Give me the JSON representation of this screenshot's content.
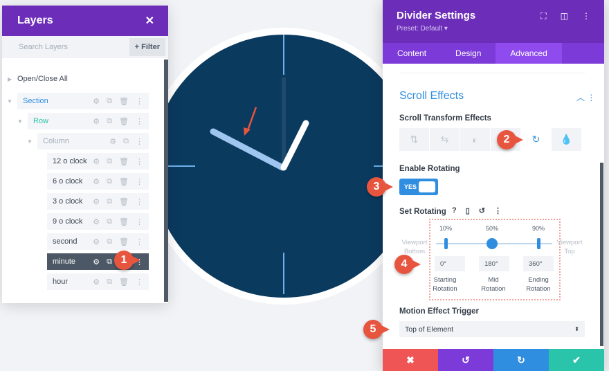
{
  "layers": {
    "title": "Layers",
    "search_placeholder": "Search Layers",
    "filter": "+ Filter",
    "open_close": "Open/Close All",
    "items": [
      {
        "label": "Section"
      },
      {
        "label": "Row"
      },
      {
        "label": "Column"
      },
      {
        "label": "12 o clock"
      },
      {
        "label": "6 o clock"
      },
      {
        "label": "3 o clock"
      },
      {
        "label": "9 o clock"
      },
      {
        "label": "second"
      },
      {
        "label": "minute"
      },
      {
        "label": "hour"
      }
    ]
  },
  "settings": {
    "title": "Divider Settings",
    "preset": "Preset: Default ▾",
    "tabs": [
      "Content",
      "Design",
      "Advanced"
    ],
    "active_tab": "Advanced",
    "section": "Scroll Effects",
    "transform_label": "Scroll Transform Effects",
    "enable_label": "Enable Rotating",
    "toggle": "YES",
    "set_label": "Set Rotating",
    "percents": [
      "10%",
      "50%",
      "90%"
    ],
    "viewport_bottom": "Viewport Bottom",
    "viewport_top": "Viewport Top",
    "values": [
      "0°",
      "180°",
      "360°"
    ],
    "captions": [
      "Starting Rotation",
      "Mid Rotation",
      "Ending Rotation"
    ],
    "trigger_label": "Motion Effect Trigger",
    "trigger_value": "Top of Element"
  },
  "badges": [
    "1",
    "2",
    "3",
    "4",
    "5"
  ],
  "colors": {
    "purple": "#6c2eb9",
    "accent": "#2f8ee0",
    "clock_face": "#0b3a5f",
    "badge": "#e8553f"
  }
}
